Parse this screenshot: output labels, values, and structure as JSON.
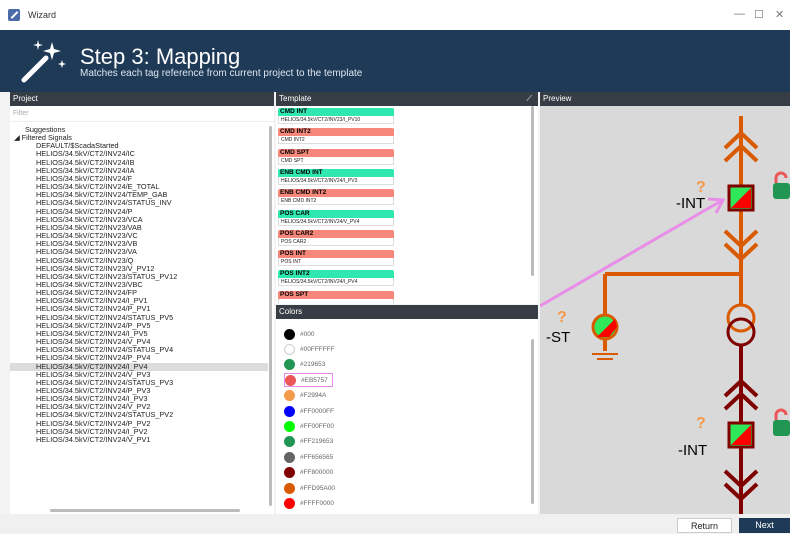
{
  "window": {
    "title": "Wizard",
    "controls": [
      "—",
      "☐",
      "✕"
    ]
  },
  "header": {
    "title": "Step 3: Mapping",
    "subtitle": "Matches each tag reference from current project to the template"
  },
  "project": {
    "title": "Project",
    "filter_placeholder": "Filter",
    "items": [
      "Suggestions",
      "◢ Filtered Signals",
      "DEFAULT/$ScadaStarted",
      "HELIOS/34.5kV/CT2/INV24/IC",
      "HELIOS/34.5kV/CT2/INV24/IB",
      "HELIOS/34.5kV/CT2/INV24/IA",
      "HELIOS/34.5kV/CT2/INV24/F",
      "HELIOS/34.5kV/CT2/INV24/E_TOTAL",
      "HELIOS/34.5kV/CT2/INV24/TEMP_GAB",
      "HELIOS/34.5kV/CT2/INV24/STATUS_INV",
      "HELIOS/34.5kV/CT2/INV24/P",
      "HELIOS/34.5kV/CT2/INV23/VCA",
      "HELIOS/34.5kV/CT2/INV23/VAB",
      "HELIOS/34.5kV/CT2/INV23/VC",
      "HELIOS/34.5kV/CT2/INV23/VB",
      "HELIOS/34.5kV/CT2/INV23/VA",
      "HELIOS/34.5kV/CT2/INV23/Q",
      "HELIOS/34.5kV/CT2/INV23/V_PV12",
      "HELIOS/34.5kV/CT2/INV23/STATUS_PV12",
      "HELIOS/34.5kV/CT2/INV23/VBC",
      "HELIOS/34.5kV/CT2/INV24/FP",
      "HELIOS/34.5kV/CT2/INV24/I_PV1",
      "HELIOS/34.5kV/CT2/INV24/P_PV1",
      "HELIOS/34.5kV/CT2/INV24/STATUS_PV5",
      "HELIOS/34.5kV/CT2/INV24/P_PV5",
      "HELIOS/34.5kV/CT2/INV24/I_PV5",
      "HELIOS/34.5kV/CT2/INV24/V_PV4",
      "HELIOS/34.5kV/CT2/INV24/STATUS_PV4",
      "HELIOS/34.5kV/CT2/INV24/P_PV4",
      "HELIOS/34.5kV/CT2/INV24/I_PV4",
      "HELIOS/34.5kV/CT2/INV24/V_PV3",
      "HELIOS/34.5kV/CT2/INV24/STATUS_PV3",
      "HELIOS/34.5kV/CT2/INV24/P_PV3",
      "HELIOS/34.5kV/CT2/INV24/I_PV3",
      "HELIOS/34.5kV/CT2/INV24/V_PV2",
      "HELIOS/34.5kV/CT2/INV24/STATUS_PV2",
      "HELIOS/34.5kV/CT2/INV24/P_PV2",
      "HELIOS/34.5kV/CT2/INV24/I_PV2",
      "HELIOS/34.5kV/CT2/INV24/V_PV1"
    ]
  },
  "template": {
    "title": "Template",
    "cards": [
      {
        "name": "CMD INT",
        "value": "HELIOS/34.5kV/CT2/INV23/I_PV10",
        "color": "#2ee8b0"
      },
      {
        "name": "CMD INT2",
        "value": "CMD INT2",
        "color": "#f7877a"
      },
      {
        "name": "CMD SPT",
        "value": "CMD SPT",
        "color": "#f7877a"
      },
      {
        "name": "ENB CMD INT",
        "value": "HELIOS/34.5kV/CT2/INV24/I_PV3",
        "color": "#2ee8b0"
      },
      {
        "name": "ENB CMD INT2",
        "value": "ENB CMD INT2",
        "color": "#f7877a"
      },
      {
        "name": "POS CAR",
        "value": "HELIOS/34.5kV/CT2/INV24/V_PV4",
        "color": "#2ee8b0"
      },
      {
        "name": "POS CAR2",
        "value": "POS CAR2",
        "color": "#f7877a"
      },
      {
        "name": "POS INT",
        "value": "POS INT",
        "color": "#f7877a"
      },
      {
        "name": "POS INT2",
        "value": "HELIOS/34.5kV/CT2/INV24/I_PV4",
        "color": "#2ee8b0"
      },
      {
        "name": "POS SPT",
        "value": "",
        "color": "#f7877a"
      }
    ]
  },
  "colors": {
    "title": "Colors",
    "items": [
      {
        "label": "#000",
        "color": "#000000"
      },
      {
        "label": "#00FFFFFF",
        "color": "#ffffff"
      },
      {
        "label": "#219653",
        "color": "#219653"
      },
      {
        "label": "#EB5757",
        "color": "#EB5757"
      },
      {
        "label": "#F2994A",
        "color": "#F2994A"
      },
      {
        "label": "#FF0000FF",
        "color": "#0000ff"
      },
      {
        "label": "#FF00FF00",
        "color": "#00ff00"
      },
      {
        "label": "#FF219653",
        "color": "#219653"
      },
      {
        "label": "#FF656565",
        "color": "#656565"
      },
      {
        "label": "#FF800000",
        "color": "#800000"
      },
      {
        "label": "#FFD95A00",
        "color": "#D95A00"
      },
      {
        "label": "#FFFF0000",
        "color": "#ff0000"
      }
    ]
  },
  "preview": {
    "title": "Preview",
    "labels": {
      "int_top": "-INT",
      "st": "-ST",
      "int_bottom": "-INT",
      "question": "?"
    }
  },
  "footer": {
    "return_label": "Return",
    "next_label": "Next"
  },
  "accents": {
    "header_bg": "#1e3a57",
    "line_orange": "#d95a00",
    "maroon": "#800000",
    "arrow": "#e98ee8"
  }
}
